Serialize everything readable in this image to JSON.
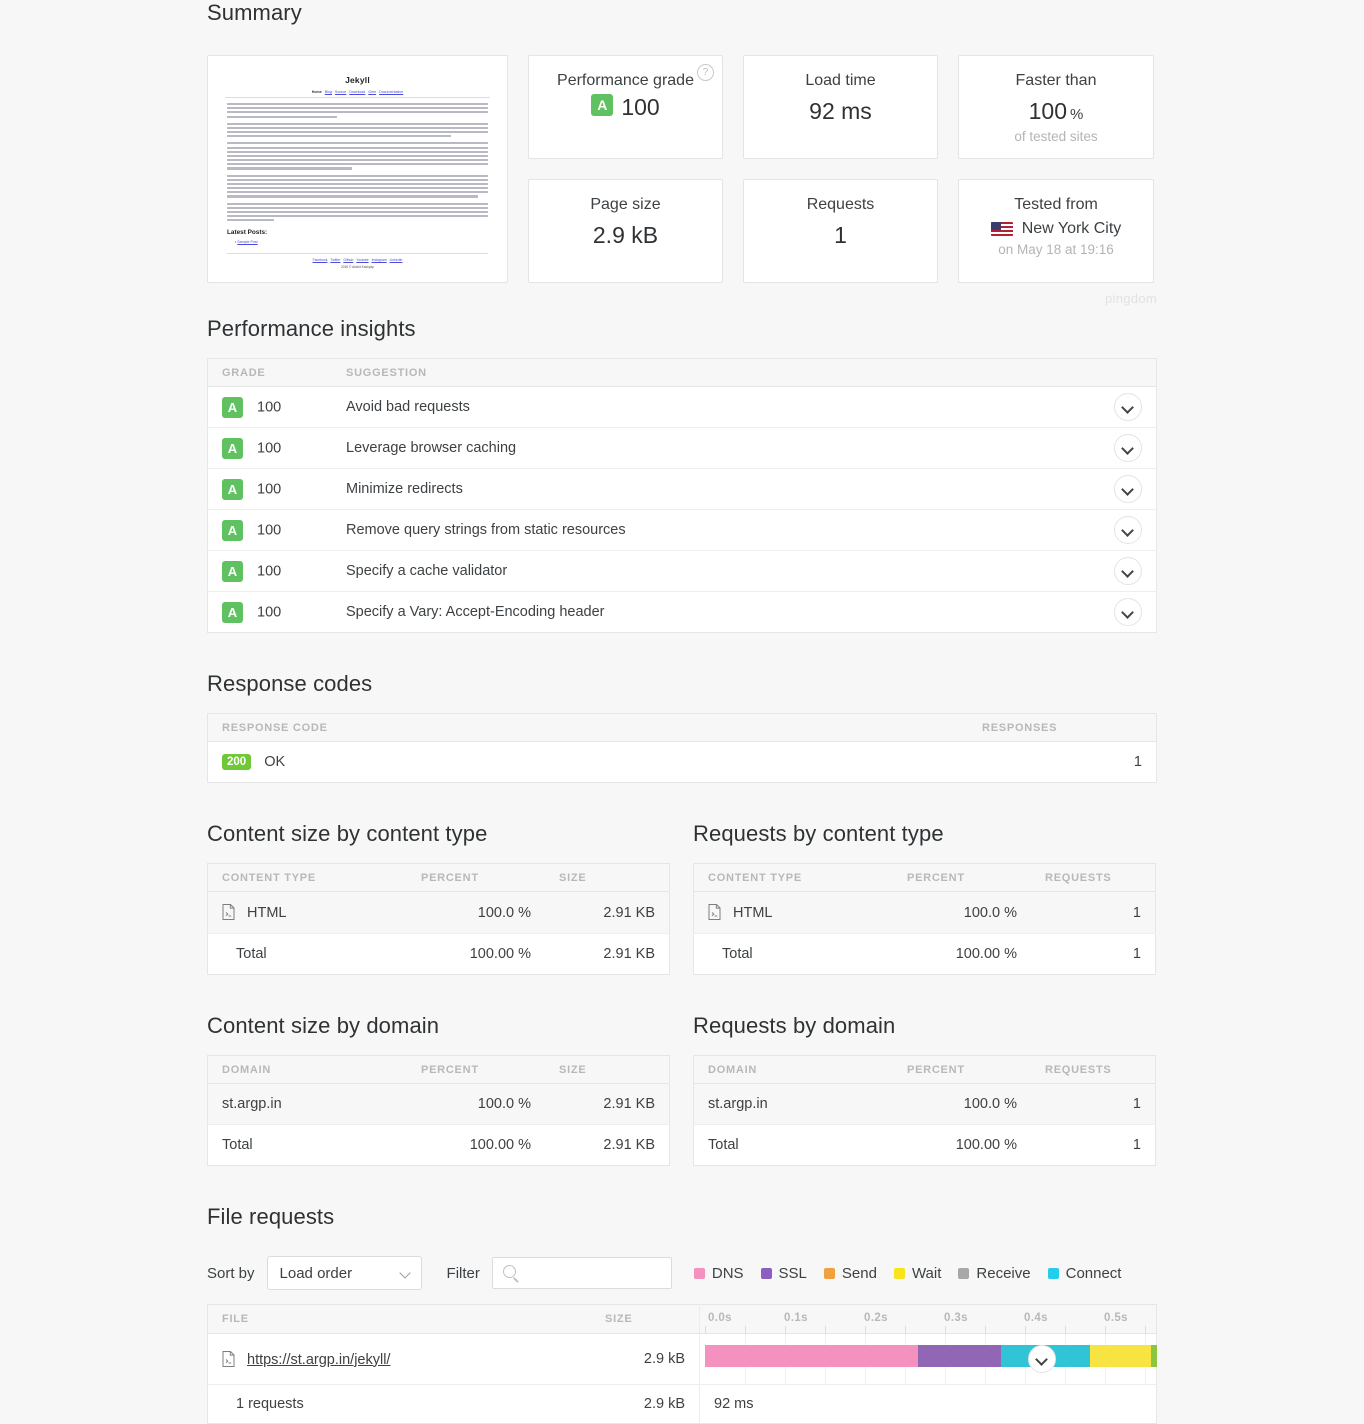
{
  "sections": {
    "summary": "Summary",
    "insights": "Performance insights",
    "response_codes": "Response codes",
    "content_size_type": "Content size by content type",
    "requests_type": "Requests by content type",
    "content_size_domain": "Content size by domain",
    "requests_domain": "Requests by domain",
    "file_requests": "File requests"
  },
  "thumbnail": {
    "site_title": "Jekyll",
    "nav_home": "Home",
    "nav_links": [
      "Blog",
      "Source",
      "Download",
      "Gem",
      "Documentation"
    ],
    "heading_posts": "Latest Posts:",
    "post_link": "Sample Post",
    "footer_links": [
      "Facebook",
      "Twitter",
      "Github",
      "Youtube",
      "Instagram",
      "LinkedIn"
    ],
    "copyright": "2018 © Akshit Kashyap"
  },
  "stats": {
    "performance_grade_label": "Performance grade",
    "performance_grade_letter": "A",
    "performance_grade_value": "100",
    "help_icon": "?",
    "load_time_label": "Load time",
    "load_time_value": "92 ms",
    "faster_than_label": "Faster than",
    "faster_than_value": "100",
    "faster_than_unit": "%",
    "faster_than_note": "of tested sites",
    "page_size_label": "Page size",
    "page_size_value": "2.9 kB",
    "requests_label": "Requests",
    "requests_value": "1",
    "tested_from_label": "Tested from",
    "tested_from_city": "New York City",
    "tested_from_date": "on May 18 at 19:16",
    "brand": "pingdom"
  },
  "insights": {
    "columns": [
      "GRADE",
      "SUGGESTION"
    ],
    "rows": [
      {
        "grade_letter": "A",
        "grade_value": "100",
        "suggestion": "Avoid bad requests"
      },
      {
        "grade_letter": "A",
        "grade_value": "100",
        "suggestion": "Leverage browser caching"
      },
      {
        "grade_letter": "A",
        "grade_value": "100",
        "suggestion": "Minimize redirects"
      },
      {
        "grade_letter": "A",
        "grade_value": "100",
        "suggestion": "Remove query strings from static resources"
      },
      {
        "grade_letter": "A",
        "grade_value": "100",
        "suggestion": "Specify a cache validator"
      },
      {
        "grade_letter": "A",
        "grade_value": "100",
        "suggestion": "Specify a Vary: Accept-Encoding header"
      }
    ]
  },
  "response_codes": {
    "columns": [
      "RESPONSE CODE",
      "RESPONSES"
    ],
    "rows": [
      {
        "code": "200",
        "text": "OK",
        "responses": "1"
      }
    ]
  },
  "content_size_type": {
    "columns": [
      "CONTENT TYPE",
      "PERCENT",
      "SIZE"
    ],
    "rows": [
      {
        "type": "HTML",
        "percent": "100.0 %",
        "size": "2.91 KB"
      }
    ],
    "total": {
      "label": "Total",
      "percent": "100.00 %",
      "size": "2.91 KB"
    }
  },
  "requests_type": {
    "columns": [
      "CONTENT TYPE",
      "PERCENT",
      "REQUESTS"
    ],
    "rows": [
      {
        "type": "HTML",
        "percent": "100.0 %",
        "requests": "1"
      }
    ],
    "total": {
      "label": "Total",
      "percent": "100.00 %",
      "requests": "1"
    }
  },
  "content_size_domain": {
    "columns": [
      "DOMAIN",
      "PERCENT",
      "SIZE"
    ],
    "rows": [
      {
        "domain": "st.argp.in",
        "percent": "100.0 %",
        "size": "2.91 KB"
      }
    ],
    "total": {
      "label": "Total",
      "percent": "100.00 %",
      "size": "2.91 KB"
    }
  },
  "requests_domain": {
    "columns": [
      "DOMAIN",
      "PERCENT",
      "REQUESTS"
    ],
    "rows": [
      {
        "domain": "st.argp.in",
        "percent": "100.0 %",
        "requests": "1"
      }
    ],
    "total": {
      "label": "Total",
      "percent": "100.00 %",
      "requests": "1"
    }
  },
  "file_requests": {
    "sort_label": "Sort by",
    "sort_value": "Load order",
    "sort_options": [
      "Load order"
    ],
    "filter_label": "Filter",
    "filter_value": "",
    "filter_placeholder": "",
    "legend": [
      {
        "name": "DNS",
        "color": "#f491bf"
      },
      {
        "name": "SSL",
        "color": "#8a5fc0"
      },
      {
        "name": "Send",
        "color": "#f0a03c"
      },
      {
        "name": "Wait",
        "color": "#f7e519"
      },
      {
        "name": "Receive",
        "color": "#a8a8a8"
      },
      {
        "name": "Connect",
        "color": "#22cdee"
      }
    ],
    "columns": [
      "FILE",
      "SIZE"
    ],
    "axis_ticks": [
      "0.0s",
      "0.1s",
      "0.2s",
      "0.3s",
      "0.4s",
      "0.5s"
    ],
    "rows": [
      {
        "url": "https://st.argp.in/jekyll/",
        "size": "2.9 kB",
        "segments": [
          {
            "name": "DNS",
            "color": "#f491bf",
            "start_pct": 0.0,
            "width_pct": 47.3
          },
          {
            "name": "SSL",
            "color": "#9167b5",
            "start_pct": 47.3,
            "width_pct": 18.3
          },
          {
            "name": "Connect",
            "color": "#31c3d6",
            "start_pct": 65.6,
            "width_pct": 19.8
          },
          {
            "name": "Wait",
            "color": "#f7e342",
            "start_pct": 85.4,
            "width_pct": 13.6
          },
          {
            "name": "Receive",
            "color": "#8cc63f",
            "start_pct": 99.0,
            "width_pct": 1.0
          }
        ]
      }
    ],
    "summary": {
      "count": "1 requests",
      "size": "2.9 kB",
      "time": "92 ms"
    }
  }
}
